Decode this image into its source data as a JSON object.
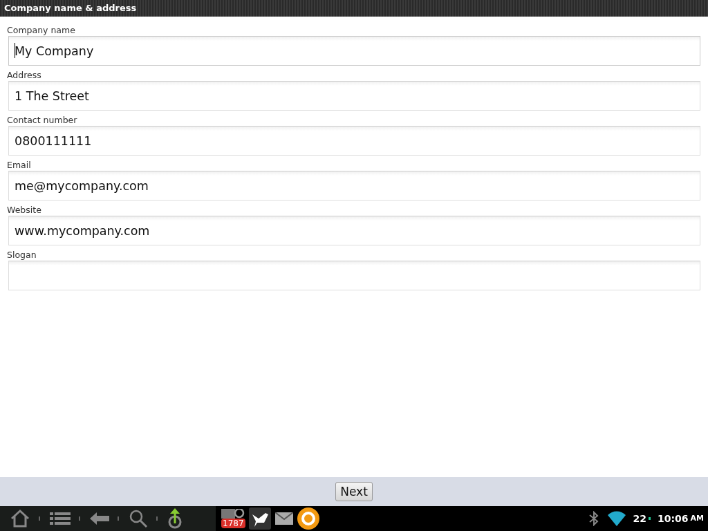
{
  "window": {
    "title": "Company name & address"
  },
  "fields": [
    {
      "label": "Company name",
      "value": "My Company",
      "focused": true
    },
    {
      "label": "Address",
      "value": "1 The Street",
      "focused": false
    },
    {
      "label": "Contact number",
      "value": "0800111111",
      "focused": false
    },
    {
      "label": "Email",
      "value": "me@mycompany.com",
      "focused": false
    },
    {
      "label": "Website",
      "value": "www.mycompany.com",
      "focused": false
    },
    {
      "label": "Slogan",
      "focused": false
    }
  ],
  "buttons": [
    "Next"
  ],
  "status_bar": {
    "mail_count": "1787",
    "battery": "22",
    "time": "10:06",
    "ampm": "AM"
  }
}
